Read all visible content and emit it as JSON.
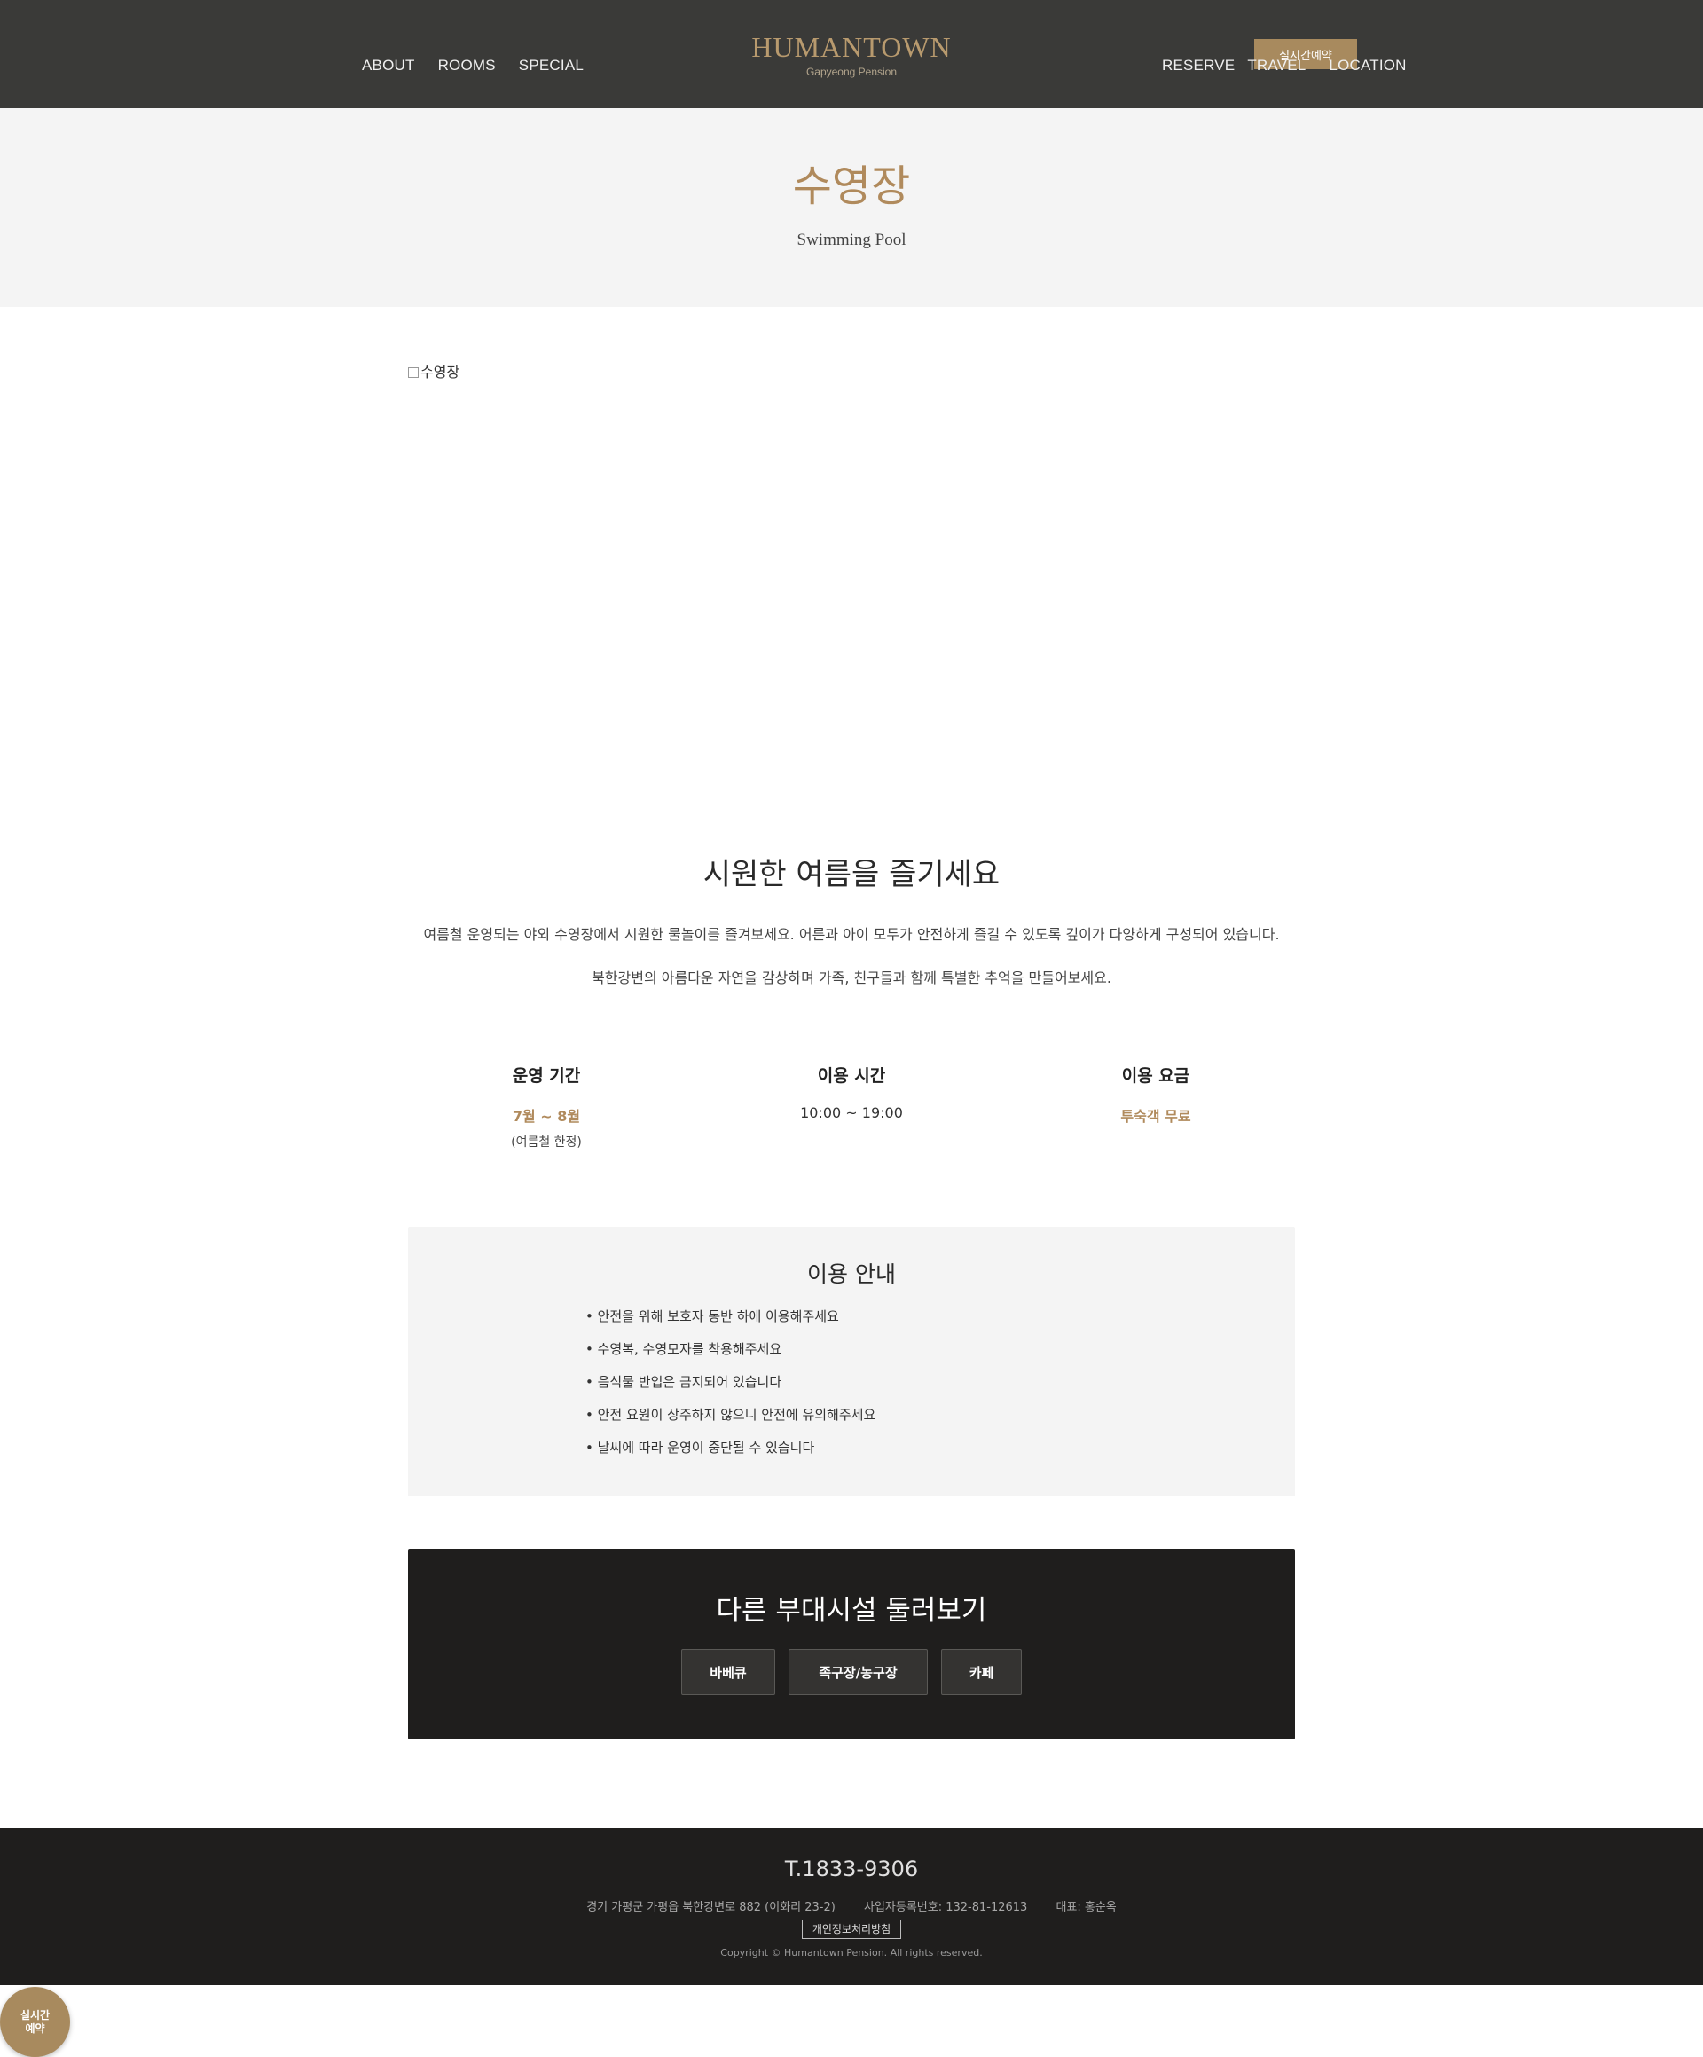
{
  "header": {
    "nav_left": [
      "ABOUT",
      "ROOMS",
      "SPECIAL"
    ],
    "nav_right": [
      "RESERVE",
      "TRAVEL",
      "LOCATION"
    ],
    "logo_title": "HUMANTOWN",
    "logo_sub": "Gapyeong Pension",
    "reserve_button": "실시간예약"
  },
  "page": {
    "title": "수영장",
    "subtitle": "Swimming Pool",
    "image_alt": "수영장"
  },
  "intro": {
    "heading": "시원한 여름을 즐기세요",
    "paragraph1": "여름철 운영되는 야외 수영장에서 시원한 물놀이를 즐겨보세요. 어른과 아이 모두가 안전하게 즐길 수 있도록 깊이가 다양하게 구성되어 있습니다.",
    "paragraph2": "북한강변의 아름다운 자연을 감상하며 가족, 친구들과 함께 특별한 추억을 만들어보세요."
  },
  "info": [
    {
      "label": "운영 기간",
      "value": "7월 ~ 8월",
      "note": "(여름철 한정)"
    },
    {
      "label": "이용 시간",
      "value": "10:00 ~ 19:00"
    },
    {
      "label": "이용 요금",
      "value": "투숙객 무료"
    }
  ],
  "guide": {
    "title": "이용 안내",
    "items": [
      "• 안전을 위해 보호자 동반 하에 이용해주세요",
      "• 수영복, 수영모자를 착용해주세요",
      "• 음식물 반입은 금지되어 있습니다",
      "• 안전 요원이 상주하지 않으니 안전에 유의해주세요",
      "• 날씨에 따라 운영이 중단될 수 있습니다"
    ]
  },
  "facilities": {
    "title": "다른 부대시설 둘러보기",
    "buttons": [
      "바베큐",
      "족구장/농구장",
      "카페"
    ]
  },
  "footer": {
    "phone": "T.1833-9306",
    "address": "경기 가평군 가평읍 북한강변로 882 (이화리 23-2)",
    "business_no": "사업자등록번호: 132-81-12613",
    "ceo": "대표: 홍순옥",
    "privacy": "개인정보처리방침",
    "copyright": "Copyright © Humantown Pension. All rights reserved."
  },
  "floating_button": {
    "line1": "실시간",
    "line2": "예약"
  },
  "colors": {
    "header_bg": "#3a3a38",
    "accent": "#b08a5c",
    "dark_bg": "#1f1e1d",
    "light_bg": "#f4f4f4"
  }
}
